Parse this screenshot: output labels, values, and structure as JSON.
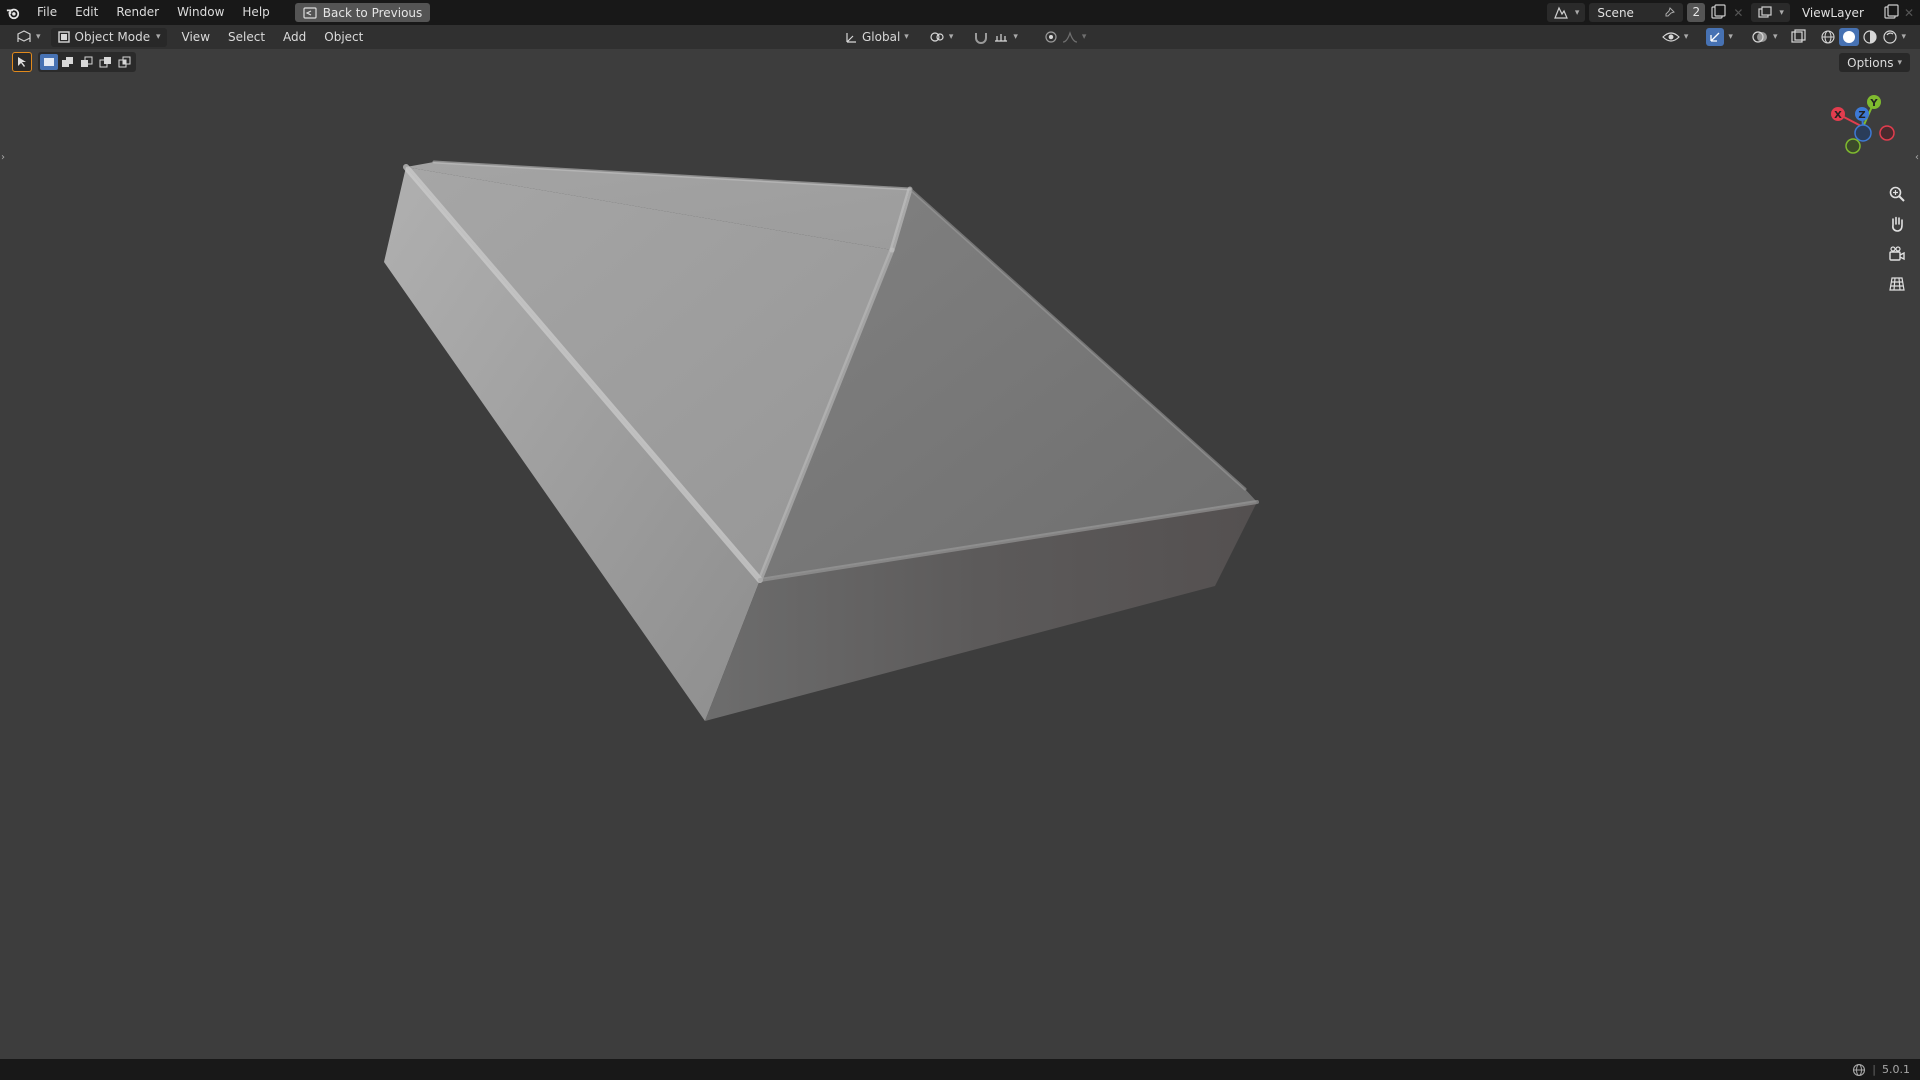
{
  "topbar": {
    "menus": [
      "File",
      "Edit",
      "Render",
      "Window",
      "Help"
    ],
    "back_label": "Back to Previous",
    "scene_name": "Scene",
    "scene_users": "2",
    "view_layer": "ViewLayer"
  },
  "header": {
    "mode_label": "Object Mode",
    "menus": [
      "View",
      "Select",
      "Add",
      "Object"
    ],
    "orientation_label": "Global"
  },
  "tool_options": {
    "options_label": "Options"
  },
  "gizmo": {
    "axes": [
      "X",
      "Y",
      "Z"
    ],
    "colors": {
      "x": "#e23d4e",
      "y": "#7fba2f",
      "z": "#3d7ad6"
    }
  },
  "statusbar": {
    "version": "5.0.1"
  },
  "theme": {
    "accent": "#4772b3",
    "active_tool_outline": "#e28a1c",
    "viewport_bg": "#3d3d3d"
  }
}
